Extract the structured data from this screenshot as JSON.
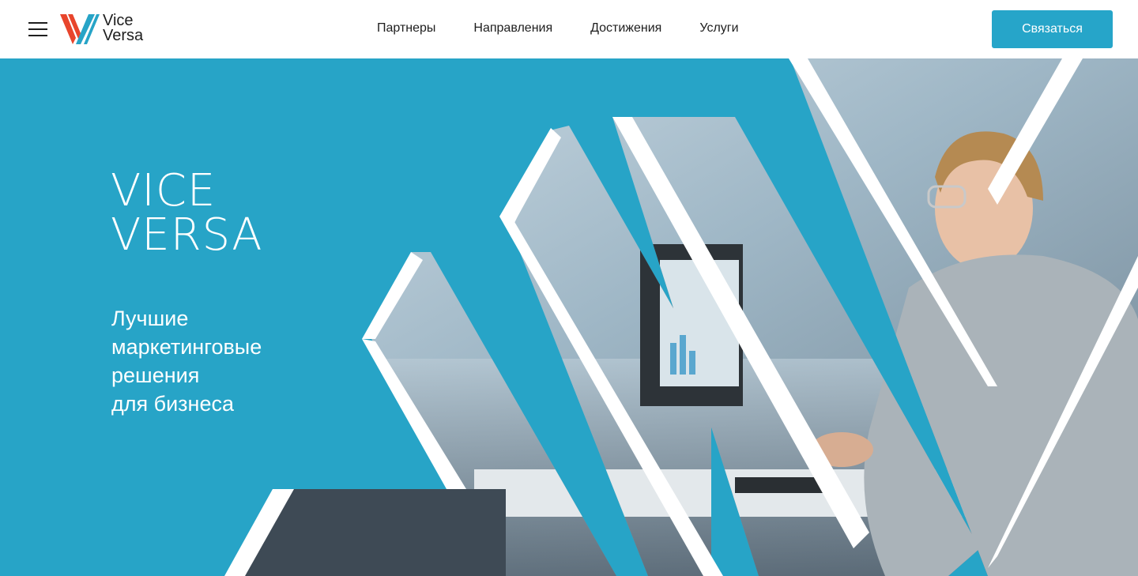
{
  "header": {
    "logo_text_line1": "Vice",
    "logo_text_line2": "Versa",
    "nav": [
      {
        "label": "Партнеры"
      },
      {
        "label": "Направления"
      },
      {
        "label": "Достижения"
      },
      {
        "label": "Услуги"
      }
    ],
    "cta_label": "Связаться"
  },
  "hero": {
    "brand_line1": "VICE",
    "brand_line2": "VERSA",
    "tagline": [
      "Лучшие",
      "маркетинговые",
      "решения",
      "для бизнеса"
    ]
  },
  "colors": {
    "accent": "#27a4c7",
    "logo_red": "#e8452c",
    "text": "#1e1e1e"
  }
}
